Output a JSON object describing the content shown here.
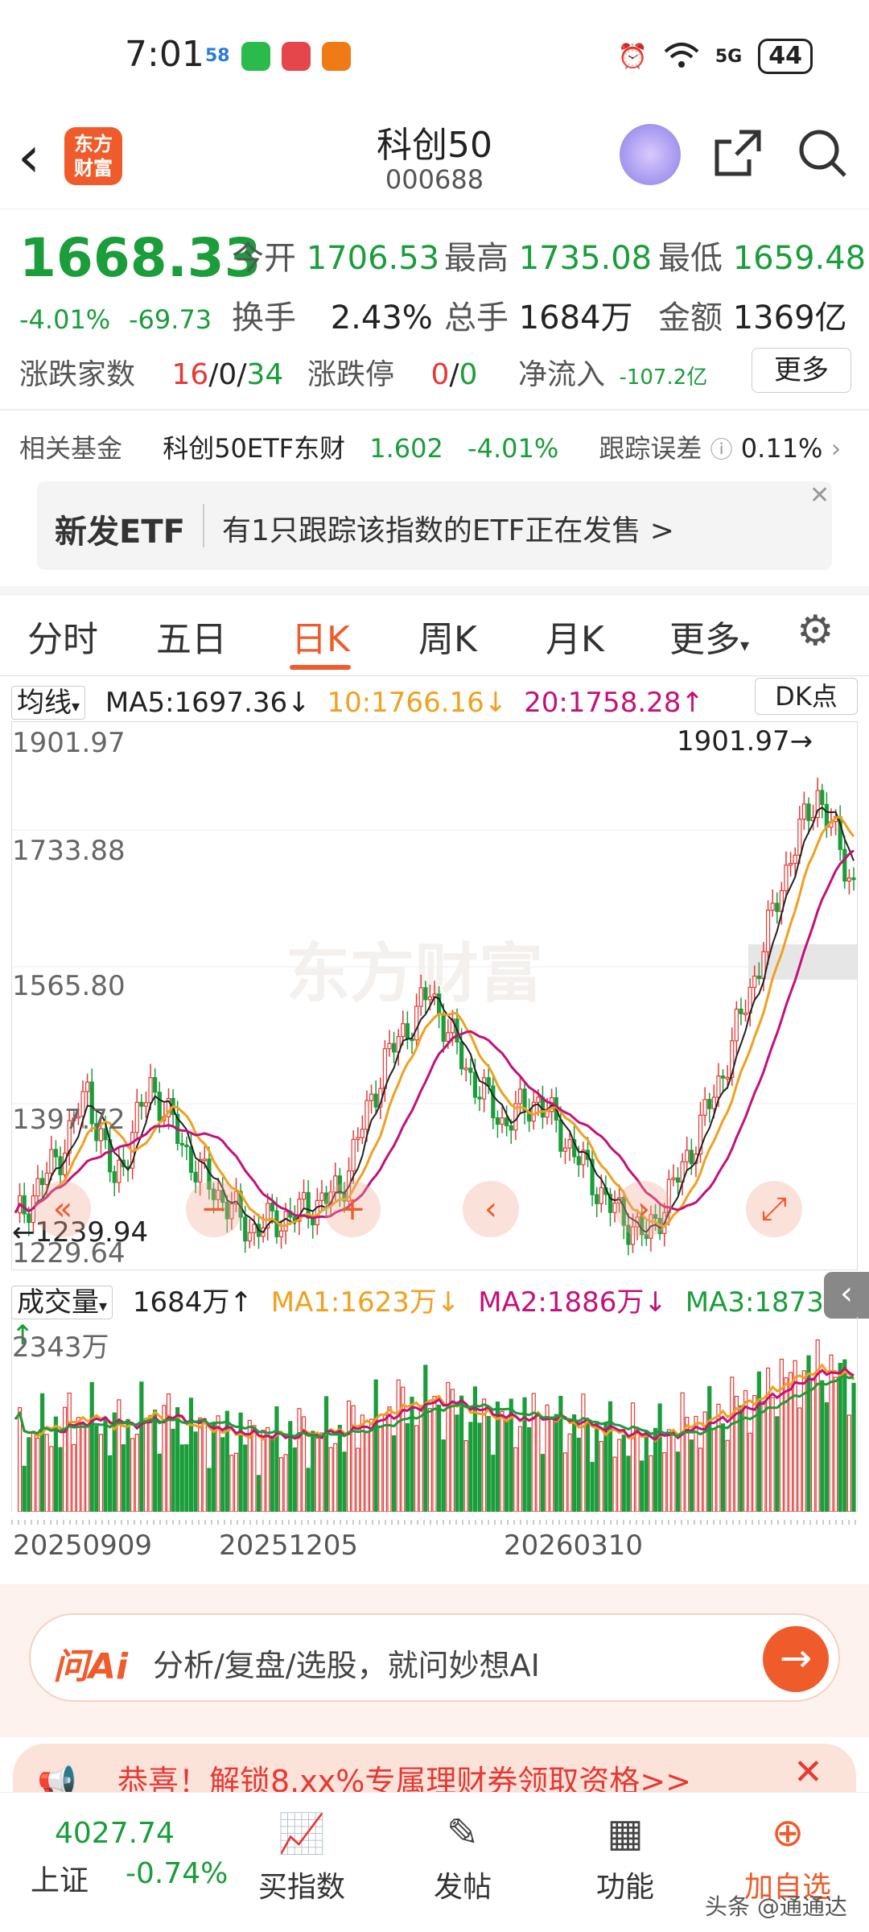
{
  "status": {
    "time": "7:01",
    "battery": "44",
    "network": "5G"
  },
  "header": {
    "title": "科创50",
    "code": "000688",
    "logo_line1": "东方",
    "logo_line2": "财富"
  },
  "quote": {
    "price": "1668.33",
    "chg_pct": "-4.01%",
    "chg_abs": "-69.73",
    "open_label": "今开",
    "open": "1706.53",
    "high_label": "最高",
    "high": "1735.08",
    "low_label": "最低",
    "low": "1659.48",
    "turnover_label": "换手",
    "turnover": "2.43%",
    "volume_label": "总手",
    "volume": "1684万",
    "amount_label": "金额",
    "amount": "1369亿",
    "breadth_label": "涨跌家数",
    "breadth_up": "16",
    "breadth_flat": "0",
    "breadth_down": "34",
    "limit_label": "涨跌停",
    "limit_up": "0",
    "limit_down": "0",
    "netflow_label": "净流入",
    "netflow": "-107.2亿",
    "more": "更多"
  },
  "fund": {
    "label": "相关基金",
    "name": "科创50ETF东财",
    "price": "1.602",
    "chg": "-4.01%",
    "track_label": "跟踪误差",
    "track_value": "0.11%"
  },
  "etf_banner": {
    "tag": "新发ETF",
    "text": "有1只跟踪该指数的ETF正在发售  >"
  },
  "tabs": [
    "分时",
    "五日",
    "日K",
    "周K",
    "月K",
    "更多"
  ],
  "ma": {
    "select": "均线",
    "ma5": "MA5:1697.36↓",
    "ma10": "10:1766.16↓",
    "ma20": "20:1758.28↑",
    "dk": "DK点"
  },
  "kchart_axis": [
    "1901.97",
    "1733.88",
    "1565.80",
    "1397.72",
    "1229.64"
  ],
  "kchart_marks": {
    "high": "1901.97",
    "low": "1239.94",
    "watermark": "东方财富"
  },
  "vol": {
    "select": "成交量",
    "value": "1684万↑",
    "ma1": "MA1:1623万↓",
    "ma2": "MA2:1886万↓",
    "ma3": "MA3:1873万↑",
    "axis_top": "2343万"
  },
  "dates": [
    "20250909",
    "20251205",
    "20260310"
  ],
  "ai": {
    "logo": "问Ai",
    "placeholder": "分析/复盘/选股，就问妙想AI"
  },
  "promo": {
    "text": "恭喜！解锁8.xx%专属理财券领取资格>>"
  },
  "nav": {
    "index_value": "4027.74",
    "index_name": "上证",
    "index_chg": "-0.74%",
    "items": [
      "买指数",
      "发帖",
      "功能",
      "加自选"
    ],
    "watermark": "头条 @通通达"
  },
  "colors": {
    "up": "#e53935",
    "down": "#1a9d3a",
    "accent": "#ef5b2b"
  }
}
